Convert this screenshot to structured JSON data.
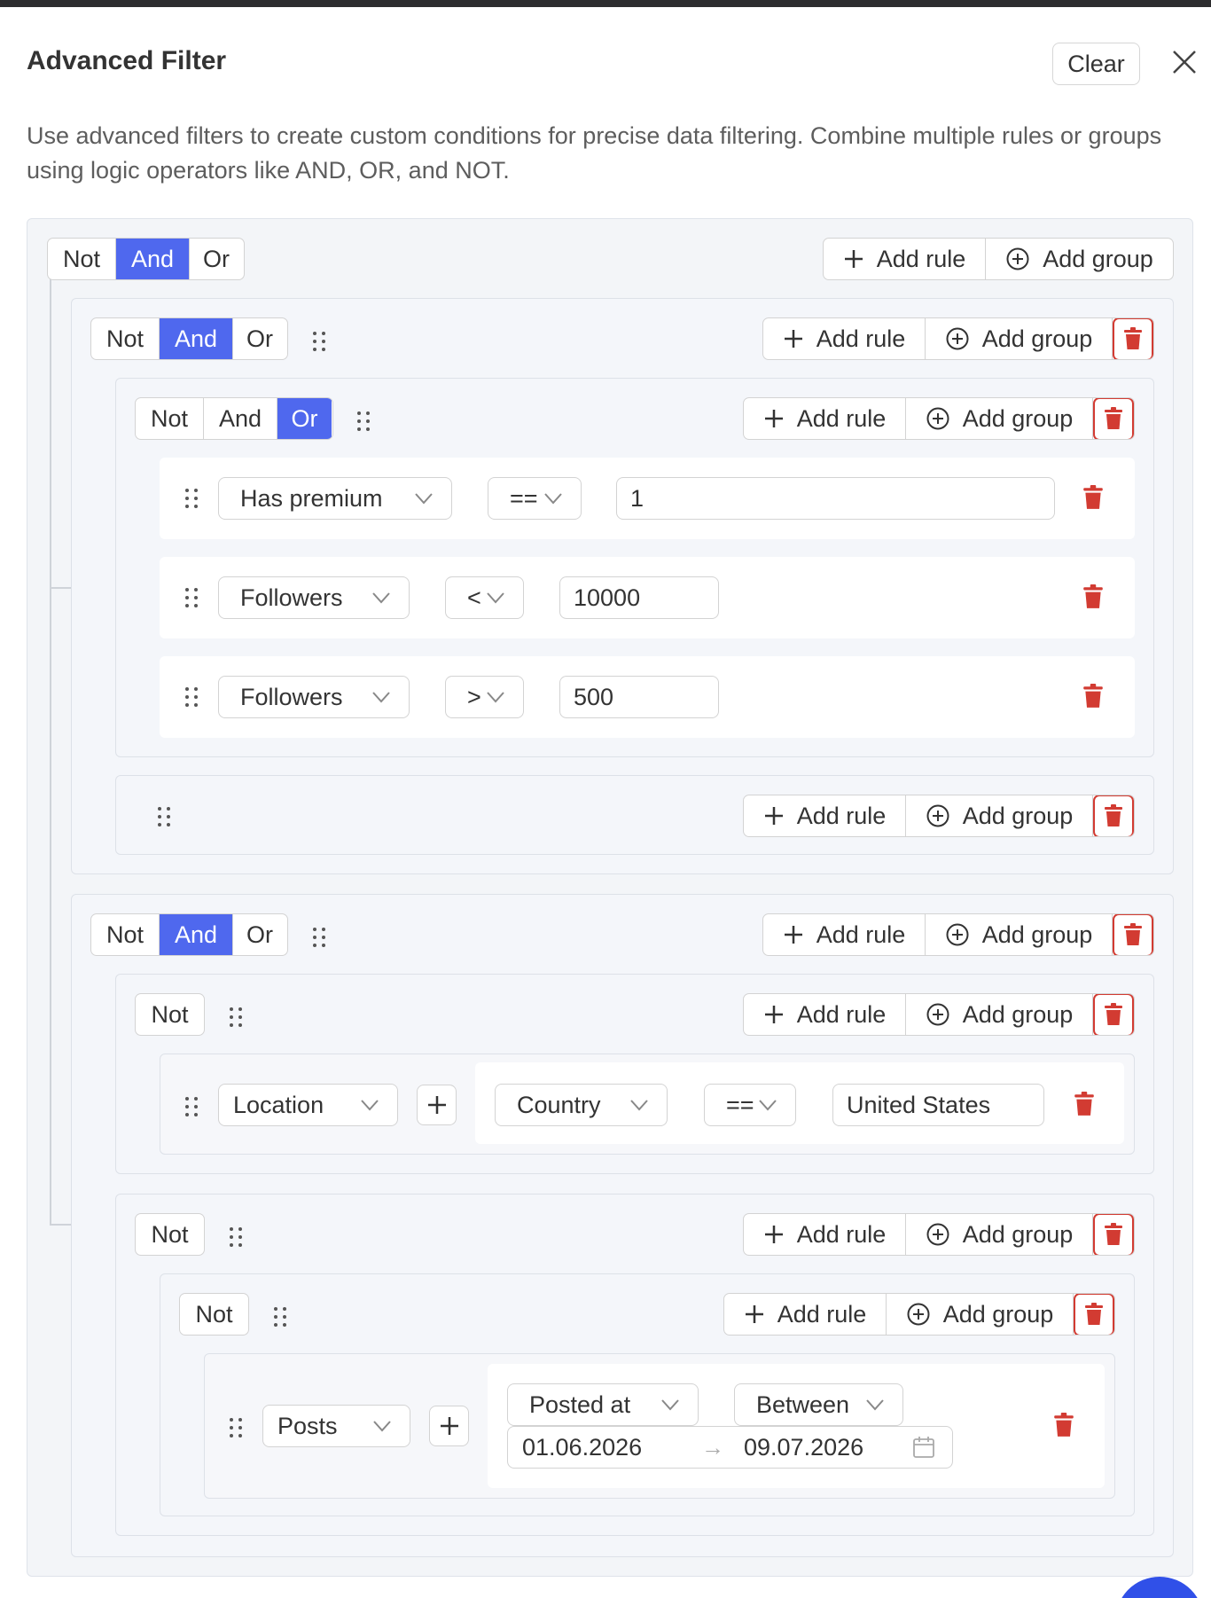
{
  "header": {
    "title": "Advanced Filter",
    "clear_label": "Clear",
    "description": "Use advanced filters to create custom conditions for precise data filtering. Combine multiple rules or groups using logic operators like AND, OR, and NOT."
  },
  "combinators": {
    "not": "Not",
    "and": "And",
    "or": "Or"
  },
  "actions": {
    "add_rule": "Add rule",
    "add_group": "Add group"
  },
  "colors": {
    "accent": "#4f68ee",
    "danger": "#d23b32"
  },
  "groups": {
    "root": {
      "combinator": "And"
    },
    "g1": {
      "combinator": "And"
    },
    "g1a": {
      "combinator": "Or",
      "rules": [
        {
          "field": "Has premium",
          "operator": "==",
          "value": "1"
        },
        {
          "field": "Followers",
          "operator": "<",
          "value": "10000"
        },
        {
          "field": "Followers",
          "operator": ">",
          "value": "500"
        }
      ]
    },
    "g2": {
      "combinator": "And"
    },
    "g2a": {
      "combinator": "Not",
      "rule": {
        "field": "Location",
        "subfield": "Country",
        "operator": "==",
        "value": "United States"
      }
    },
    "g2b": {
      "combinator": "Not"
    },
    "g2b1": {
      "combinator": "Not",
      "rule": {
        "field": "Posts",
        "subfield": "Posted at",
        "operator": "Between",
        "date_from": "01.06.2026",
        "date_arrow": "→",
        "date_to": "09.07.2026"
      }
    }
  }
}
